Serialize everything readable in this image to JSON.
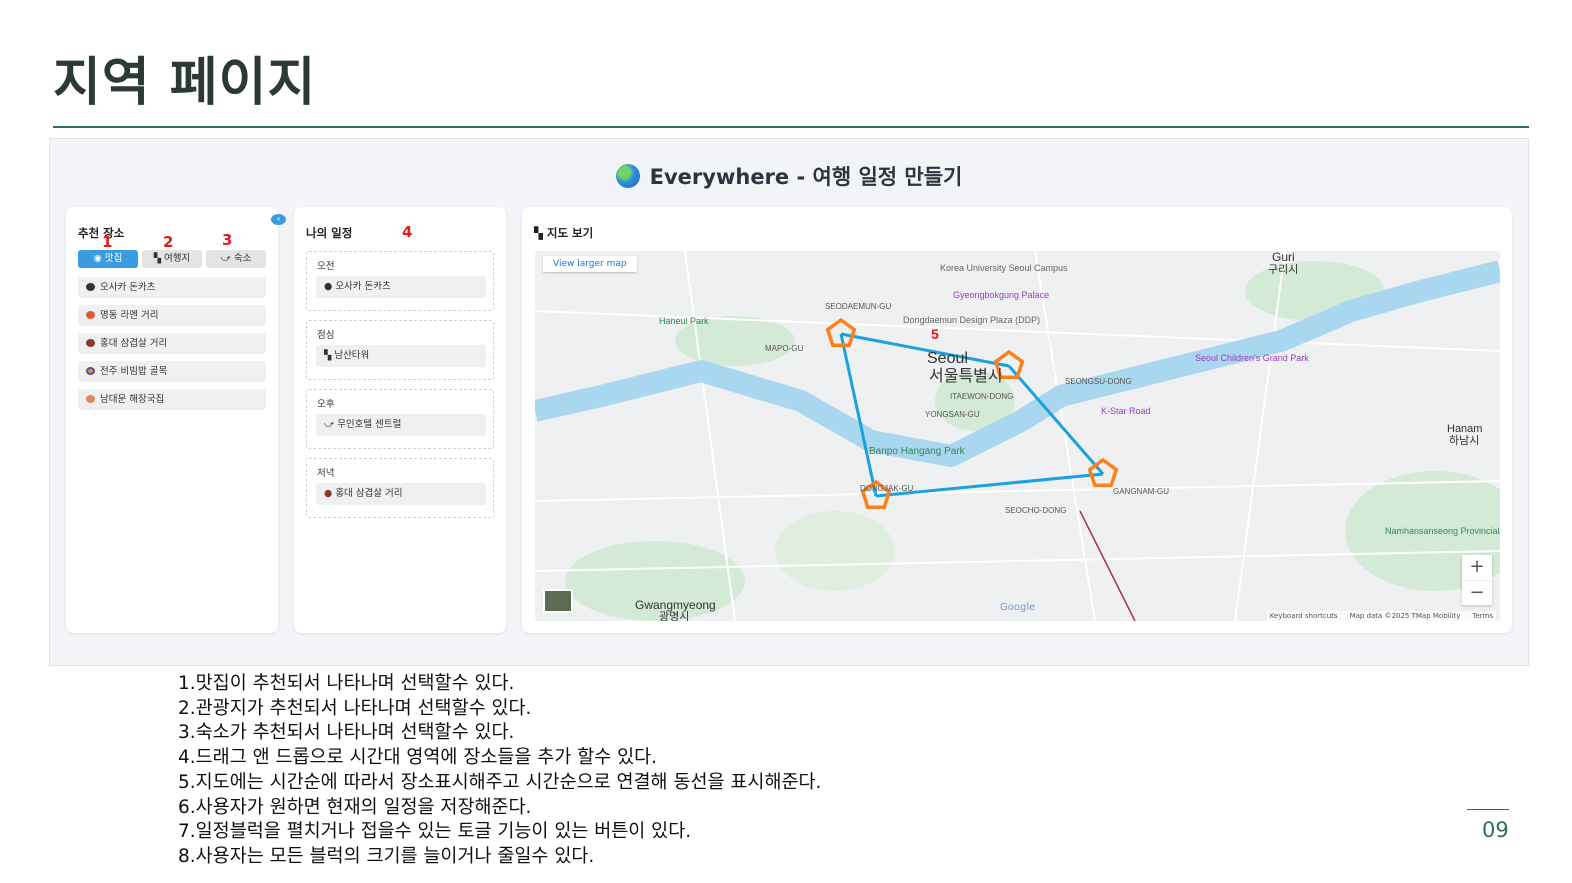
{
  "slide": {
    "title": "지역 페이지",
    "page_number": "09"
  },
  "app": {
    "title": "Everywhere - 여행 일정 만들기",
    "recommend": {
      "heading": "추천 장소",
      "collapse_icon": "double-chevron-left-icon",
      "tabs": [
        {
          "label": "맛집",
          "icon": "plate-icon",
          "active": true
        },
        {
          "label": "여행지",
          "icon": "map-icon",
          "active": false
        },
        {
          "label": "숙소",
          "icon": "bed-icon",
          "active": false
        }
      ],
      "items": [
        {
          "label": "오사카 돈카츠",
          "color": "#333"
        },
        {
          "label": "명동 라멘 거리",
          "color": "#e05a3a"
        },
        {
          "label": "홍대 삼겹살 거리",
          "color": "#8b3a2a"
        },
        {
          "label": "전주 비빔밥 골목",
          "color": "#c9a020"
        },
        {
          "label": "남대문 해장국집",
          "color": "#e08a5a"
        }
      ]
    },
    "schedule": {
      "heading": "나의 일정",
      "slots": [
        {
          "label": "오전",
          "item": "오사카 돈카츠"
        },
        {
          "label": "점심",
          "item": "남산타워"
        },
        {
          "label": "오후",
          "item": "무인호텔 센트럴"
        },
        {
          "label": "저녁",
          "item": "홍대 삼겹살 거리"
        }
      ]
    },
    "map": {
      "heading": "지도 보기",
      "view_larger": "View larger map",
      "zoom_in": "+",
      "zoom_out": "−",
      "attribution": {
        "shortcuts": "Keyboard shortcuts",
        "data": "Map data ©2025 TMap Mobility",
        "terms": "Terms"
      },
      "google": "Google",
      "labels": [
        "Seoul",
        "서울특별시",
        "Banpo Hangang Park",
        "Gwangmyeong",
        "광명시",
        "Guri",
        "구리시",
        "Hanam",
        "하남시",
        "Dongdaemun Design Plaza (DDP)",
        "Korea University Seoul Campus",
        "Gyeongbokgung Palace",
        "K-Star Road",
        "Seoul Children's Grand Park",
        "Haneul Park",
        "Namhansanseong Provincial Park",
        "ITAEWON-DONG",
        "YONGSAN-GU",
        "GANGNAM-GU",
        "SEOCHO-DONG",
        "DONGJAK-GU",
        "SEODAEMUN-GU",
        "MAPO-GU",
        "SEONGSU-DONG"
      ],
      "route_color": "#1ba0e0",
      "marker_color": "#ff7f1a"
    },
    "annotations": [
      "1",
      "2",
      "3",
      "4",
      "5"
    ]
  },
  "description": [
    "1.맛집이 추천되서 나타나며 선택할수 있다.",
    "2.관광지가 추천되서 나타나며 선택할수 있다.",
    "3.숙소가 추천되서 나타나며 선택할수 있다.",
    "4.드래그 앤 드롭으로 시간대 영역에 장소들을 추가 할수 있다.",
    "5.지도에는 시간순에 따라서 장소표시해주고 시간순으로 연결해 동선을 표시해준다.",
    "6.사용자가 원하면 현재의 일정을 저장해준다.",
    "7.일정블럭을 펼치거나 접을수 있는 토글 기능이 있는 버튼이 있다.",
    "8.사용자는 모든 블럭의 크기를 늘이거나 줄일수 있다."
  ]
}
